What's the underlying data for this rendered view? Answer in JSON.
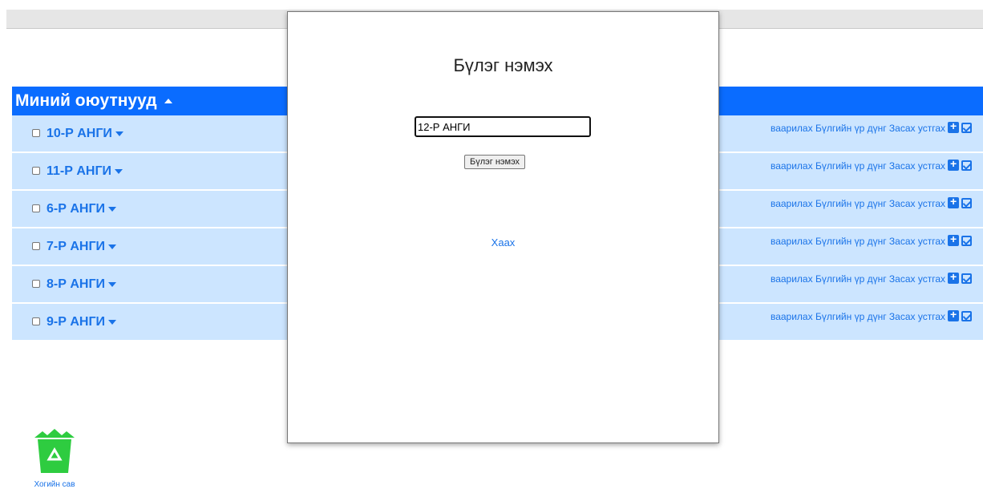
{
  "section": {
    "title": "Миний оюутнууд"
  },
  "groups": [
    {
      "label": "10-Р АНГИ",
      "actions": "ваарилах Бүлгийн үр дүнг Засах устгах"
    },
    {
      "label": "11-Р АНГИ",
      "actions": "ваарилах Бүлгийн үр дүнг Засах устгах"
    },
    {
      "label": "6-Р АНГИ",
      "actions": "ваарилах Бүлгийн үр дүнг Засах устгах"
    },
    {
      "label": "7-Р АНГИ",
      "actions": "ваарилах Бүлгийн үр дүнг Засах устгах"
    },
    {
      "label": "8-Р АНГИ",
      "actions": "ваарилах Бүлгийн үр дүнг Засах устгах"
    },
    {
      "label": "9-Р АНГИ",
      "actions": "ваарилах Бүлгийн үр дүнг Засах устгах"
    }
  ],
  "modal": {
    "title": "Бүлэг нэмэх",
    "input_value": "12-Р АНГИ",
    "submit_label": "Бүлэг нэмэх",
    "close_label": "Хаах"
  },
  "trash": {
    "label": "Хогийн сав"
  },
  "colors": {
    "accent": "#0a6cff",
    "row_bg": "#cce5ff",
    "trash_green": "#2ecc40"
  }
}
